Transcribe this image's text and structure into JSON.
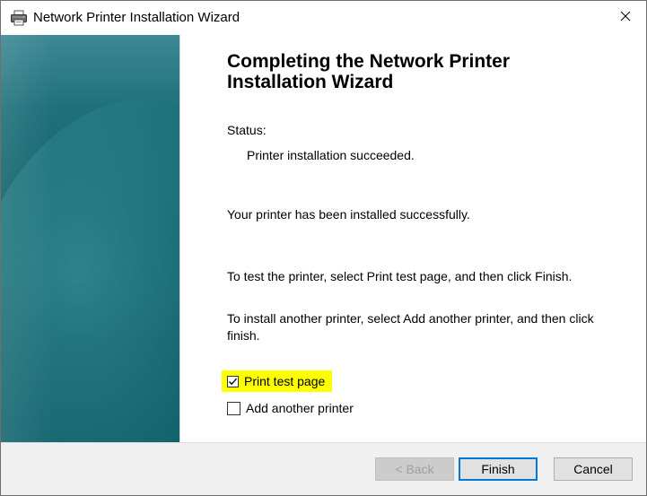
{
  "window": {
    "title": "Network Printer Installation Wizard",
    "icon": "printer-icon",
    "close_glyph": "✕"
  },
  "main": {
    "heading": "Completing the Network Printer Installation Wizard",
    "status_label": "Status:",
    "status_value": "Printer installation succeeded.",
    "installed_message": "Your printer has been installed successfully.",
    "test_instruction": "To test the printer, select Print test page, and then click Finish.",
    "another_instruction": "To install another printer, select Add another printer, and then click finish.",
    "options": {
      "print_test_page": {
        "label": "Print test page",
        "checked": true
      },
      "add_another_printer": {
        "label": "Add another printer",
        "checked": false
      }
    }
  },
  "footer": {
    "back_label": "< Back",
    "finish_label": "Finish",
    "cancel_label": "Cancel"
  },
  "colors": {
    "highlight": "#ffff00",
    "banner_teal": "#0f5f69",
    "default_button_border": "#0078d7"
  }
}
